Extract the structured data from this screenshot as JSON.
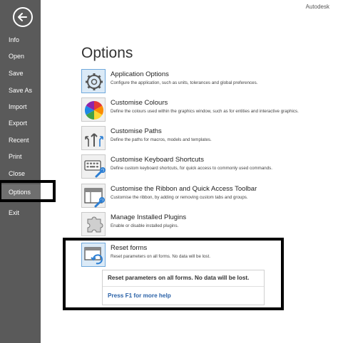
{
  "brand": "Autodesk",
  "sidebar": {
    "items": [
      {
        "label": "Info"
      },
      {
        "label": "Open"
      },
      {
        "label": "Save"
      },
      {
        "label": "Save As"
      },
      {
        "label": "Import"
      },
      {
        "label": "Export"
      },
      {
        "label": "Recent"
      },
      {
        "label": "Print"
      },
      {
        "label": "Close"
      },
      {
        "label": "Options",
        "active": true
      },
      {
        "label": "Exit"
      }
    ]
  },
  "main": {
    "title": "Options",
    "options": [
      {
        "icon": "gear-icon",
        "title": "Application Options",
        "desc": "Configure the application, such as units, tolerances and global preferences."
      },
      {
        "icon": "color-wheel-icon",
        "title": "Customise Colours",
        "desc": "Define the colours used within the graphics window, such as for entities and interactive graphics."
      },
      {
        "icon": "paths-icon",
        "title": "Customise Paths",
        "desc": "Define the paths for macros, models and templates."
      },
      {
        "icon": "keyboard-icon",
        "title": "Customise Keyboard Shortcuts",
        "desc": "Define custom keyboard shortcuts, for quick access to commonly used commands."
      },
      {
        "icon": "ribbon-customise-icon",
        "title": "Customise the Ribbon and Quick Access Toolbar",
        "desc": "Customise the ribbon, by adding or removing custom tabs and groups."
      },
      {
        "icon": "plugin-icon",
        "title": "Manage Installed Plugins",
        "desc": "Enable or disable installed plugins."
      },
      {
        "icon": "reset-forms-icon",
        "title": "Reset forms",
        "desc": "Reset parameters on all forms. No data will be lost."
      }
    ],
    "tooltip": {
      "text": "Reset parameters on all forms. No data will be lost.",
      "help": "Press F1 for more help"
    }
  },
  "colors": {
    "sidebar_bg": "#5a5a5a",
    "accent_blue": "#2c63a8",
    "annotation_border": "#000000"
  }
}
